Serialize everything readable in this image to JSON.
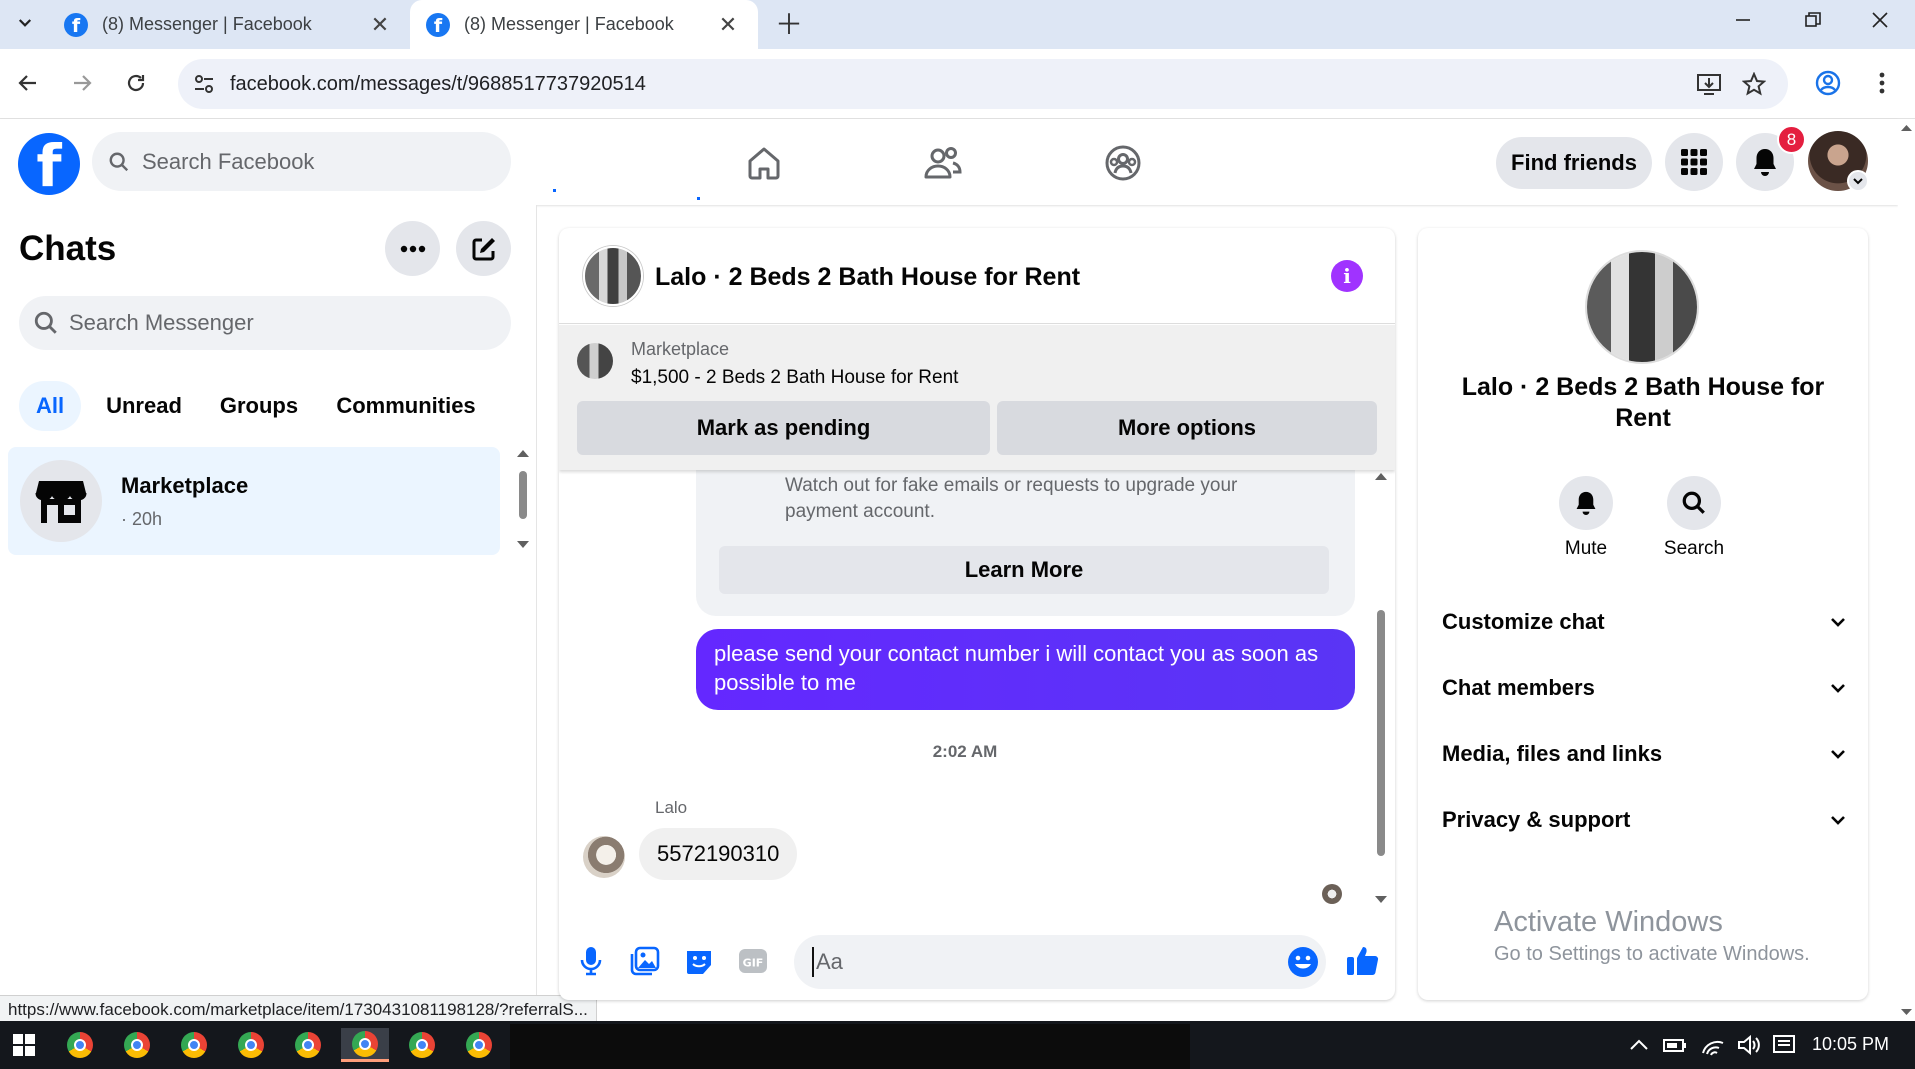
{
  "browser": {
    "tabs": [
      {
        "title": "(8) Messenger | Facebook",
        "active": false
      },
      {
        "title": "(8) Messenger | Facebook",
        "active": true
      }
    ],
    "url": "facebook.com/messages/t/9688517737920514",
    "status_url": "https://www.facebook.com/marketplace/item/1730431081198128/?referralS..."
  },
  "fb_nav": {
    "search_placeholder": "Search Facebook",
    "find_friends_label": "Find friends",
    "notification_count": "8",
    "brand_color": "#0866ff",
    "icons": [
      "home-icon",
      "friends-icon",
      "groups-icon",
      "menu-grid-icon",
      "bell-icon"
    ]
  },
  "chats": {
    "title": "Chats",
    "search_placeholder": "Search Messenger",
    "filters": [
      "All",
      "Unread",
      "Groups",
      "Communities"
    ],
    "active_filter": "All",
    "items": [
      {
        "name": "Marketplace",
        "time": "· 20h",
        "icon": "storefront-icon"
      }
    ]
  },
  "conversation": {
    "title": "Lalo · 2 Beds 2 Bath House for Rent",
    "marketplace": {
      "label": "Marketplace",
      "price_line": "$1,500 - 2 Beds 2 Bath House for Rent",
      "pending_label": "Mark as pending",
      "more_label": "More options"
    },
    "warning": {
      "text": "Watch out for fake emails or requests to upgrade your payment account.",
      "learn_more": "Learn More"
    },
    "messages": [
      {
        "direction": "outgoing",
        "text": "please send your contact number i will contact you as soon as possible to me"
      },
      {
        "direction": "incoming",
        "sender": "Lalo",
        "text": "5572190310"
      }
    ],
    "timestamp": "2:02 AM",
    "composer_placeholder": "Aa",
    "outgoing_color": "#5f30fb"
  },
  "info_panel": {
    "title": "Lalo · 2 Beds 2 Bath House for Rent",
    "actions": [
      "Mute",
      "Search"
    ],
    "sections": [
      "Customize chat",
      "Chat members",
      "Media, files and links",
      "Privacy & support"
    ]
  },
  "watermark": {
    "line1": "Activate Windows",
    "line2": "Go to Settings to activate Windows."
  },
  "taskbar": {
    "clock": "10:05 PM"
  }
}
